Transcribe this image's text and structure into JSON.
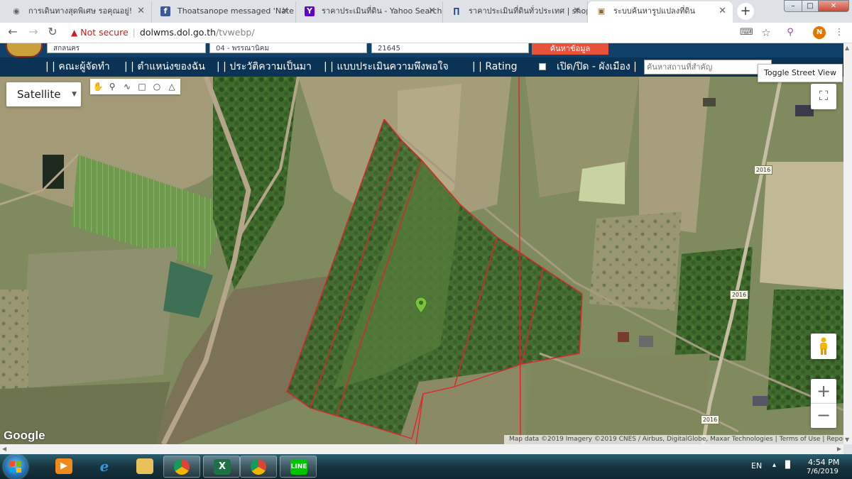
{
  "browser": {
    "tabs": [
      {
        "title": "การเดินทางสุดพิเศษ รอคุณอยู่!",
        "favicon": "globe-icon",
        "active": false
      },
      {
        "title": "Thoatsanope messaged 'Nate N",
        "favicon": "facebook-icon",
        "active": false
      },
      {
        "title": "ราคาประเมินที่ดิน - Yahoo Search",
        "favicon": "yahoo-icon",
        "active": false
      },
      {
        "title": "ราคาประเมินที่ดินทั่วประเทศ | shop",
        "favicon": "treasury-icon",
        "active": false
      },
      {
        "title": "ระบบค้นหารูปแปลงที่ดิน",
        "favicon": "box-icon",
        "active": true
      }
    ],
    "new_tab_label": "+",
    "address": {
      "security_label": "Not secure",
      "host": "dolwms.dol.go.th",
      "path": "/tvwebp/"
    },
    "profile_initial": "N"
  },
  "page": {
    "header": {
      "province_value": "สกลนคร",
      "district_value": "04 - พรรณานิคม",
      "parcel_value": "21645",
      "search_button": "ค้นหาข้อมูล"
    },
    "menu": {
      "items": [
        "| | คณะผู้จัดทำ",
        "| | ตำแหน่งของฉัน",
        "| | ประวัติความเป็นมา",
        "| | แบบประเมินความพึงพอใจ",
        "| | Rating",
        "เปิด/ปิด - ผังเมือง |"
      ],
      "place_search_placeholder": "ค้นหาสถานที่สำคัญ"
    },
    "toggle_street_view": "Toggle Street View"
  },
  "map": {
    "map_type": "Satellite",
    "zoom_in": "+",
    "zoom_out": "−",
    "google_logo": "Google",
    "road_shields": [
      "2016",
      "2016",
      "2016"
    ],
    "attribution": {
      "data": "Map data ©2019 Imagery ©2019 CNES / Airbus, DigitalGlobe, Maxar Technologies",
      "terms": "Terms of Use",
      "report": "Report a map error"
    },
    "parcel_outline_color": "#e0242a"
  },
  "taskbar": {
    "language": "EN",
    "time": "4:54 PM",
    "date": "7/6/2019",
    "apps": [
      "windows-media-player-icon",
      "internet-explorer-icon",
      "file-explorer-icon",
      "chrome-icon",
      "excel-icon",
      "chrome-icon",
      "line-icon"
    ]
  }
}
